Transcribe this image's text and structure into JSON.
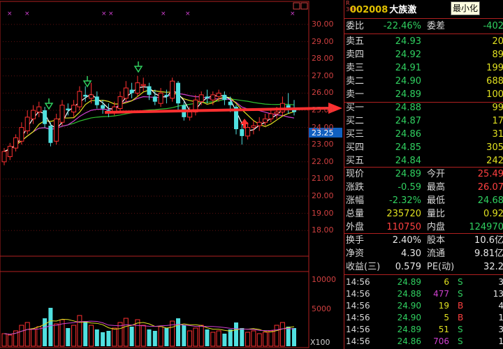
{
  "header": {
    "market_badge": "R",
    "market_sub": "300",
    "code": "002008",
    "name": "大族激",
    "tooltip": "最小化",
    "icon": "restore-window-icon"
  },
  "chart": {
    "y_ticks": [
      "30.00",
      "29.00",
      "28.00",
      "27.00",
      "26.00",
      "25.00",
      "24.00",
      "23.00",
      "22.00",
      "21.00",
      "20.00",
      "19.00",
      "18.00"
    ],
    "current_price_label": "23.25",
    "vol_ticks": [
      "10000",
      "5000"
    ],
    "vol_unit": "X100",
    "colors": {
      "up": "#50e0e0",
      "down": "#50e0e0",
      "ma5": "#ffffff",
      "ma10": "#e0e020",
      "ma20": "#d040d0",
      "ma60": "#30c030",
      "arrow": "#ff3030"
    }
  },
  "quote": {
    "weibi_label": "委比",
    "weibi_value": "-22.46%",
    "weicha_label": "委差",
    "weicha_value": "-402",
    "sell": [
      {
        "label": "卖五",
        "price": "24.93",
        "vol": "20"
      },
      {
        "label": "卖四",
        "price": "24.92",
        "vol": "89"
      },
      {
        "label": "卖三",
        "price": "24.91",
        "vol": "199"
      },
      {
        "label": "卖二",
        "price": "24.90",
        "vol": "688"
      },
      {
        "label": "卖一",
        "price": "24.89",
        "vol": "100"
      }
    ],
    "buy": [
      {
        "label": "买一",
        "price": "24.88",
        "vol": "99"
      },
      {
        "label": "买二",
        "price": "24.87",
        "vol": "17"
      },
      {
        "label": "买三",
        "price": "24.86",
        "vol": "31"
      },
      {
        "label": "买四",
        "price": "24.85",
        "vol": "305"
      },
      {
        "label": "买五",
        "price": "24.84",
        "vol": "242"
      }
    ],
    "stats": [
      {
        "l1": "现价",
        "v1": "24.89",
        "c1": "g",
        "l2": "今开",
        "v2": "25.49",
        "c2": "r"
      },
      {
        "l1": "涨跌",
        "v1": "-0.59",
        "c1": "g",
        "l2": "最高",
        "v2": "26.07",
        "c2": "r"
      },
      {
        "l1": "涨幅",
        "v1": "-2.32%",
        "c1": "g",
        "l2": "最低",
        "v2": "24.68",
        "c2": "g"
      },
      {
        "l1": "总量",
        "v1": "235720",
        "c1": "y",
        "l2": "量比",
        "v2": "0.92",
        "c2": "y"
      },
      {
        "l1": "外盘",
        "v1": "110750",
        "c1": "r",
        "l2": "内盘",
        "v2": "124970",
        "c2": "g"
      }
    ],
    "fin": [
      {
        "l1": "换手",
        "v1": "2.40%",
        "l2": "股本",
        "v2": "10.6亿"
      },
      {
        "l1": "净资",
        "v1": "4.30",
        "l2": "流通",
        "v2": "9.81亿"
      },
      {
        "l1": "收益(三)",
        "v1": "0.579",
        "l2": "PE(动)",
        "v2": "32.2"
      }
    ]
  },
  "ticks": [
    {
      "time": "14:56",
      "price": "24.89",
      "vol": "6",
      "side": "S",
      "tail": "3"
    },
    {
      "time": "14:56",
      "price": "24.88",
      "vol": "477",
      "side": "S",
      "tail": "13"
    },
    {
      "time": "14:56",
      "price": "24.90",
      "vol": "19",
      "side": "B",
      "tail": "4"
    },
    {
      "time": "14:56",
      "price": "24.90",
      "vol": "5",
      "side": "B",
      "tail": "1"
    },
    {
      "time": "14:56",
      "price": "24.89",
      "vol": "51",
      "side": "S",
      "tail": "3"
    },
    {
      "time": "14:56",
      "price": "24.86",
      "vol": "706",
      "side": "S",
      "tail": "1"
    }
  ]
}
